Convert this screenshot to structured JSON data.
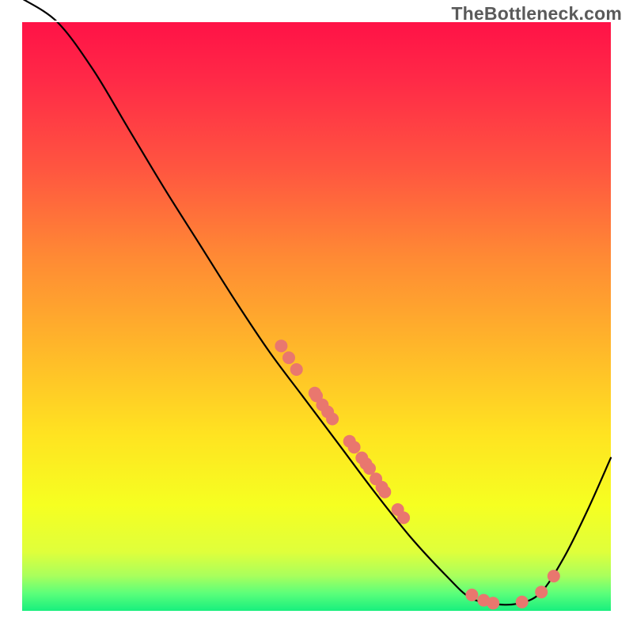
{
  "watermark": "TheBottleneck.com",
  "chart_data": {
    "type": "line",
    "title": "",
    "xlabel": "",
    "ylabel": "",
    "xlim": [
      0,
      100
    ],
    "ylim": [
      0,
      100
    ],
    "curve": [
      {
        "x": 0,
        "y": 104
      },
      {
        "x": 6,
        "y": 100
      },
      {
        "x": 12,
        "y": 92
      },
      {
        "x": 18,
        "y": 82
      },
      {
        "x": 24,
        "y": 72
      },
      {
        "x": 30,
        "y": 62.5
      },
      {
        "x": 36,
        "y": 53
      },
      {
        "x": 42,
        "y": 44
      },
      {
        "x": 48,
        "y": 36
      },
      {
        "x": 54,
        "y": 28
      },
      {
        "x": 60,
        "y": 20
      },
      {
        "x": 66,
        "y": 12.5
      },
      {
        "x": 72,
        "y": 6
      },
      {
        "x": 76,
        "y": 2.3
      },
      {
        "x": 80,
        "y": 1.2
      },
      {
        "x": 84,
        "y": 1.2
      },
      {
        "x": 88,
        "y": 3
      },
      {
        "x": 92,
        "y": 9
      },
      {
        "x": 96,
        "y": 17
      },
      {
        "x": 100,
        "y": 26
      }
    ],
    "points": [
      {
        "x": 44.0,
        "y": 45
      },
      {
        "x": 45.3,
        "y": 43
      },
      {
        "x": 46.6,
        "y": 41
      },
      {
        "x": 49.7,
        "y": 37
      },
      {
        "x": 50.0,
        "y": 36.5
      },
      {
        "x": 51.0,
        "y": 35
      },
      {
        "x": 51.9,
        "y": 33.8
      },
      {
        "x": 52.7,
        "y": 32.6
      },
      {
        "x": 55.6,
        "y": 28.8
      },
      {
        "x": 56.4,
        "y": 27.8
      },
      {
        "x": 57.7,
        "y": 26
      },
      {
        "x": 58.4,
        "y": 25
      },
      {
        "x": 59.0,
        "y": 24.2
      },
      {
        "x": 60.1,
        "y": 22.4
      },
      {
        "x": 61.1,
        "y": 21
      },
      {
        "x": 61.6,
        "y": 20.2
      },
      {
        "x": 63.8,
        "y": 17.2
      },
      {
        "x": 64.8,
        "y": 15.8
      },
      {
        "x": 76.4,
        "y": 2.7
      },
      {
        "x": 78.4,
        "y": 1.8
      },
      {
        "x": 80.0,
        "y": 1.3
      },
      {
        "x": 84.9,
        "y": 1.5
      },
      {
        "x": 88.2,
        "y": 3.2
      },
      {
        "x": 90.3,
        "y": 5.9
      }
    ],
    "colors": {
      "curve": "#000000",
      "points": "#e9776e",
      "gradient_top": "#ff1247",
      "gradient_mid": "#ffe321",
      "gradient_bottom": "#18ef7e"
    }
  }
}
